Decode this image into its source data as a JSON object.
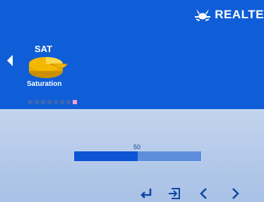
{
  "header": {
    "logo_text": "REALTE",
    "logo_icon": "crab-icon"
  },
  "menu_item": {
    "short_label": "SAT",
    "name": "Saturation",
    "icon": "saturation-icon",
    "page_indicator": {
      "count": 8,
      "active_index": 7
    }
  },
  "slider": {
    "value": "50",
    "min": 0,
    "max": 100,
    "level_fraction": 0.5
  },
  "buttons": [
    {
      "name": "enter",
      "icon": "enter-icon"
    },
    {
      "name": "exit",
      "icon": "exit-icon"
    },
    {
      "name": "previous",
      "icon": "chevron-left-icon"
    },
    {
      "name": "next",
      "icon": "chevron-right-icon"
    }
  ],
  "colors": {
    "top_panel": "#0f5ed8",
    "bottom_panel": "#b4c9e8",
    "icon_yellow": "#f5b800",
    "indicator_active": "#ff9fd2"
  }
}
